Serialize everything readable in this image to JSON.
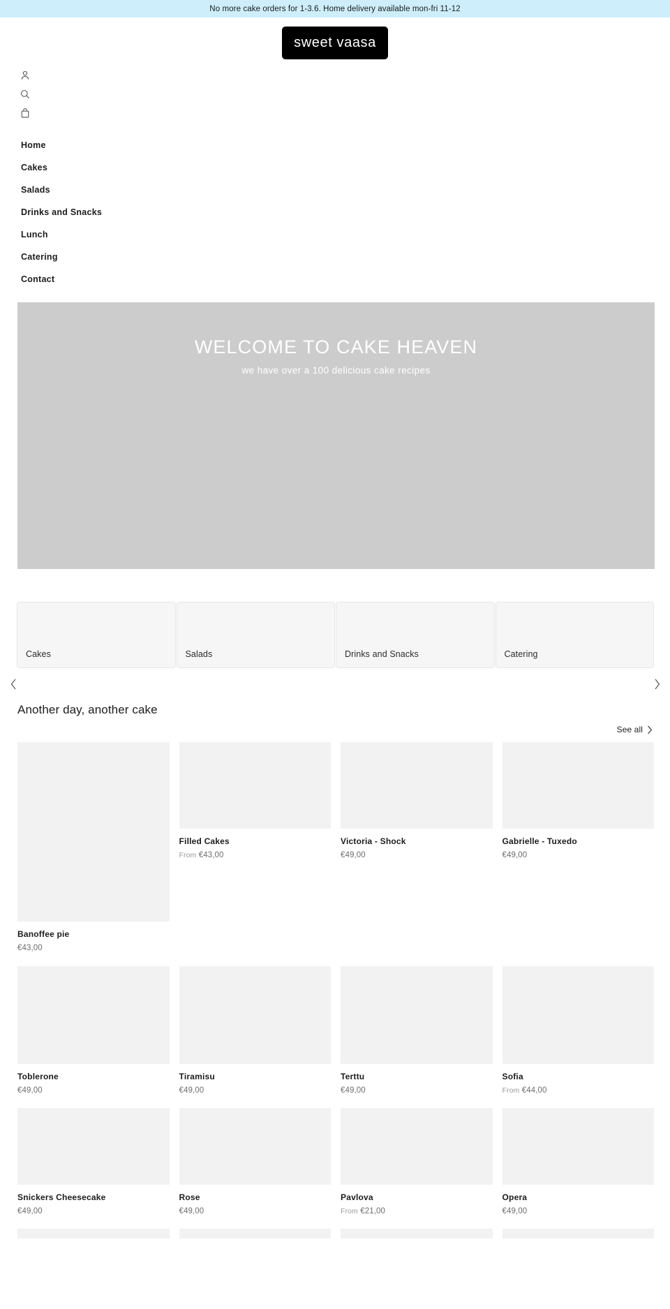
{
  "announcement": {
    "text": "No more cake orders for 1-3.6. Home delivery available mon-fri 11-12"
  },
  "header": {
    "logo_text": "sweet vaasa",
    "icons": [
      {
        "name": "account-icon",
        "label": "Account"
      },
      {
        "name": "search-icon",
        "label": "Search"
      },
      {
        "name": "cart-icon",
        "label": "Cart"
      }
    ]
  },
  "nav": {
    "items": [
      {
        "label": "Home"
      },
      {
        "label": "Cakes"
      },
      {
        "label": "Salads"
      },
      {
        "label": "Drinks and Snacks"
      },
      {
        "label": "Lunch"
      },
      {
        "label": "Catering"
      },
      {
        "label": "Contact"
      }
    ]
  },
  "hero": {
    "title": "WELCOME TO CAKE HEAVEN",
    "subtitle": "we have over a 100 delicious cake recipes",
    "background_color": "#cccccc"
  },
  "categories": {
    "cards": [
      {
        "label": "Cakes"
      },
      {
        "label": "Salads"
      },
      {
        "label": "Drinks and Snacks"
      },
      {
        "label": "Catering"
      }
    ],
    "prev_arrow": "‹",
    "next_arrow": "›"
  },
  "products_section": {
    "title": "Another day, another cake",
    "see_all_label": "See all",
    "see_all_arrow": "›",
    "rows": [
      {
        "items": [
          {
            "title": "Banoffee pie",
            "price": "€43,00",
            "from": ""
          },
          {
            "title": "Filled Cakes",
            "price": "€43,00",
            "from": "From"
          },
          {
            "title": "Victoria - Shock",
            "price": "€49,00",
            "from": ""
          },
          {
            "title": "Gabrielle - Tuxedo",
            "price": "€49,00",
            "from": ""
          }
        ]
      },
      {
        "items": [
          {
            "title": "Toblerone",
            "price": "€49,00",
            "from": ""
          },
          {
            "title": "Tiramisu",
            "price": "€49,00",
            "from": ""
          },
          {
            "title": "Terttu",
            "price": "€49,00",
            "from": ""
          },
          {
            "title": "Sofia",
            "price": "€44,00",
            "from": "From"
          }
        ]
      },
      {
        "items": [
          {
            "title": "Snickers Cheesecake",
            "price": "€49,00",
            "from": ""
          },
          {
            "title": "Rose",
            "price": "€49,00",
            "from": ""
          },
          {
            "title": "Pavlova",
            "price": "€21,00",
            "from": "From"
          },
          {
            "title": "Opera",
            "price": "€49,00",
            "from": ""
          }
        ]
      }
    ]
  },
  "colors": {
    "announcement_bg": "#cdeefa",
    "logo_bg": "#000000",
    "hero_bg": "#cccccc",
    "placeholder_bg": "#f2f2f2",
    "category_card_bg": "#f6f6f6"
  }
}
